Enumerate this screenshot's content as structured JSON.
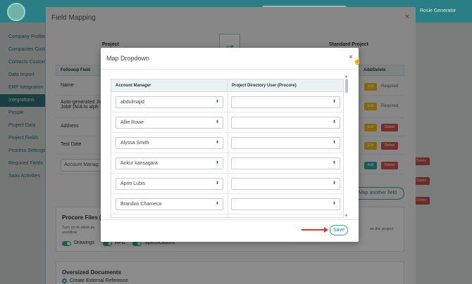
{
  "topbar": {
    "user": "Rosie Generator"
  },
  "sidebar": {
    "items": [
      {
        "label": "Company Profile"
      },
      {
        "label": "Companies Cust..."
      },
      {
        "label": "Contacts Custom..."
      },
      {
        "label": "Data Import"
      },
      {
        "label": "ERP Integration"
      },
      {
        "label": "Integrations",
        "active": true
      },
      {
        "label": "People"
      },
      {
        "label": "Project Data"
      },
      {
        "label": "Project Fields"
      },
      {
        "label": "Process Settings"
      },
      {
        "label": "Required Fields"
      },
      {
        "label": "Saas Activities"
      }
    ]
  },
  "field_mapping": {
    "title": "Field Mapping",
    "close": "×",
    "project_header": "Project",
    "standard_project_header": "Standard Project",
    "arrow_icon": "arrow-right-icon",
    "col_followup": "Followup Field",
    "col_actions": "Add/Delete",
    "rows": [
      {
        "label": "Name",
        "edit": "Edit",
        "required": "Required"
      },
      {
        "label": "Auto-generated Jo Job# (N/A to alph",
        "edit": "Edit",
        "required": "Required"
      },
      {
        "label": "Address",
        "edit": "Edit",
        "delete": "Delete"
      },
      {
        "label": "Test Date",
        "edit": "Edit",
        "delete": "Delete"
      },
      {
        "label": "Account Manag",
        "add": "Add",
        "delete": "Delete"
      }
    ],
    "map_another": "Map another field",
    "procore_title": "Procore Files (Pu",
    "procore_text": "Turn on to allow pu workflow",
    "procore_side": "on the project",
    "toggles": [
      "Drawings",
      "RFIs",
      "Specifications"
    ],
    "oversized_title": "Oversized Documents",
    "oversized_option": "Create External Reference"
  },
  "map_dropdown": {
    "title": "Map Dropdown",
    "close": "×",
    "col_account_manager": "Account Manager",
    "col_directory_user": "Project Directory User (Procore)",
    "rows": [
      {
        "manager": "abdulmajid",
        "user": ""
      },
      {
        "manager": "Allie Rowe",
        "user": ""
      },
      {
        "manager": "Alyssa Smith",
        "user": ""
      },
      {
        "manager": "Ankur kansagara",
        "user": ""
      },
      {
        "manager": "Aprin Lubis",
        "user": ""
      },
      {
        "manager": "Brandon Chameco",
        "user": ""
      }
    ],
    "save": "Save",
    "select_arrow": "⬍",
    "colors": {
      "accent": "#2fa8a0",
      "annotation": "#e0352b"
    }
  }
}
